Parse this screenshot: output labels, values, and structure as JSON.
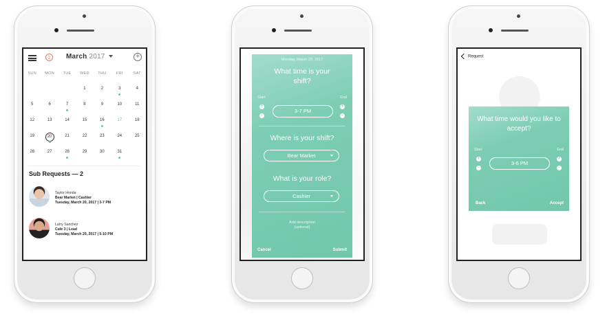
{
  "calendar": {
    "badge": "2",
    "month": "March",
    "year": "2017",
    "plus": "+",
    "days_of_week": [
      "SUN",
      "MON",
      "TUE",
      "WED",
      "THU",
      "FRI",
      "SAT"
    ],
    "weeks": [
      [
        {
          "d": ""
        },
        {
          "d": ""
        },
        {
          "d": ""
        },
        {
          "d": "1"
        },
        {
          "d": "2"
        },
        {
          "d": "3",
          "dot": true
        },
        {
          "d": "4"
        }
      ],
      [
        {
          "d": "5"
        },
        {
          "d": "6"
        },
        {
          "d": "7",
          "dot": true
        },
        {
          "d": "8"
        },
        {
          "d": "9"
        },
        {
          "d": "10"
        },
        {
          "d": "11"
        }
      ],
      [
        {
          "d": "12"
        },
        {
          "d": "13"
        },
        {
          "d": "14"
        },
        {
          "d": "15"
        },
        {
          "d": "16",
          "dot": true
        },
        {
          "d": "17",
          "green": true
        },
        {
          "d": "18"
        }
      ],
      [
        {
          "d": "19"
        },
        {
          "d": "20",
          "today": true,
          "dot": true
        },
        {
          "d": "21"
        },
        {
          "d": "22"
        },
        {
          "d": "23"
        },
        {
          "d": "24"
        },
        {
          "d": "25"
        }
      ],
      [
        {
          "d": "26"
        },
        {
          "d": "27"
        },
        {
          "d": "28",
          "dot": true
        },
        {
          "d": "29"
        },
        {
          "d": "30"
        },
        {
          "d": "31",
          "dot": true
        },
        {
          "d": ""
        }
      ]
    ],
    "sub_requests_title": "Sub Requests — 2",
    "requests": [
      {
        "name": "Taylor Honda",
        "place": "Bear Market | Cashier",
        "when": "Tuesday, March 20, 2017 | 3-7 PM"
      },
      {
        "name": "Larry Sanchez",
        "place": "Cafe 3 | Lead",
        "when": "Tuesday, March 20, 2017 | 5-10 PM"
      }
    ]
  },
  "shift_form": {
    "date": "Monday, March 20, 2017",
    "q_time": "What time is your shift?",
    "start_label": "Start",
    "end_label": "End",
    "time_value": "3-7 PM",
    "q_where": "Where is your shift?",
    "where_value": "Bear Market",
    "q_role": "What is your role?",
    "role_value": "Cashier",
    "description_hint": "Add description (optional)",
    "cancel": "Cancel",
    "submit": "Submit"
  },
  "accept_form": {
    "back_link": "Request",
    "question": "What time would you like to accept?",
    "start_label": "Start",
    "end_label": "End",
    "time_value": "3-6 PM",
    "back": "Back",
    "accept": "Accept"
  },
  "colors": {
    "accent": "#7ccdb3",
    "alert": "#e27d6f"
  }
}
